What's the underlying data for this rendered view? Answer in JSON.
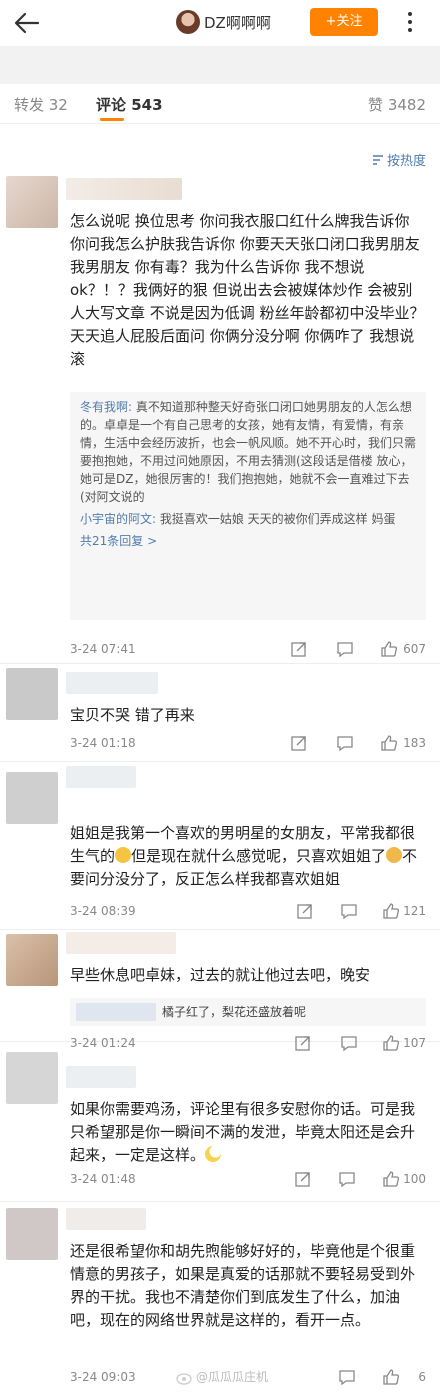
{
  "header": {
    "title": "DZ啊啊啊",
    "follow_label": "+关注"
  },
  "tabs": {
    "repost": "转发 32",
    "comment": "评论 543",
    "like": "赞 3482"
  },
  "sort_label": "按热度",
  "comments": [
    {
      "text": "怎么说呢 换位思考 你问我衣服口红什么牌我告诉你 你问我怎么护肤我告诉你 你要天天张口闭口我男朋友我男朋友 你有毒？我为什么告诉你 我不想说 ok？！？我俩好的狠 但说出去会被媒体炒作 会被别人大写文章 不说是因为低调 粉丝年龄都初中没毕业？天天追人屁股后面问 你俩分没分啊 你俩咋了 我想说 滚",
      "replies": [
        {
          "user": "冬有我啊:",
          "text": " 真不知道那种整天好奇张口闭口她男朋友的人怎么想的。卓卓是一个有自己思考的女孩，她有友情，有爱情，有亲情，生活中会经历波折，也会一帆风顺。她不开心时，我们只需要抱抱她，不用过问她原因，不用去猜测(这段话是借楼 放心，她可是DZ，她很厉害的！我们抱抱她，她就不会一直难过下去(对阿文说的"
        },
        {
          "user": "小宇宙的阿文:",
          "text": " 我挺喜欢一姑娘 天天的被你们弄成这样 妈蛋"
        }
      ],
      "more_replies": "共21条回复 >",
      "time": "3-24 07:41",
      "likes": "607"
    },
    {
      "text": "宝贝不哭 错了再来",
      "time": "3-24 01:18",
      "likes": "183"
    },
    {
      "text_a": "姐姐是我第一个喜欢的男明星的女朋友，平常我都很生气的",
      "text_b": "但是现在就什么感觉呢，只喜欢姐姐了",
      "text_c": "不要问分没分了，反正怎么样我都喜欢姐姐",
      "time": "3-24 08:39",
      "likes": "121"
    },
    {
      "text": "早些休息吧卓妹，过去的就让他过去吧，晚安",
      "reply_text": "橘子红了，梨花还盛放着呢",
      "time": "3-24 01:24",
      "likes": "107"
    },
    {
      "text": "如果你需要鸡汤，评论里有很多安慰你的话。可是我只希望那是你一瞬间不满的发泄，毕竟太阳还是会升起来，一定是这样。",
      "time": "3-24 01:48",
      "likes": "100"
    },
    {
      "text": "还是很希望你和胡先煦能够好好的，毕竟他是个很重情意的男孩子，如果是真爱的话那就不要轻易受到外界的干扰。我也不清楚你们到底发生了什么，加油吧，现在的网络世界就是这样的，看开一点。",
      "time": "3-24 09:03",
      "likes": "6"
    }
  ],
  "watermark": "@瓜瓜瓜庄机"
}
